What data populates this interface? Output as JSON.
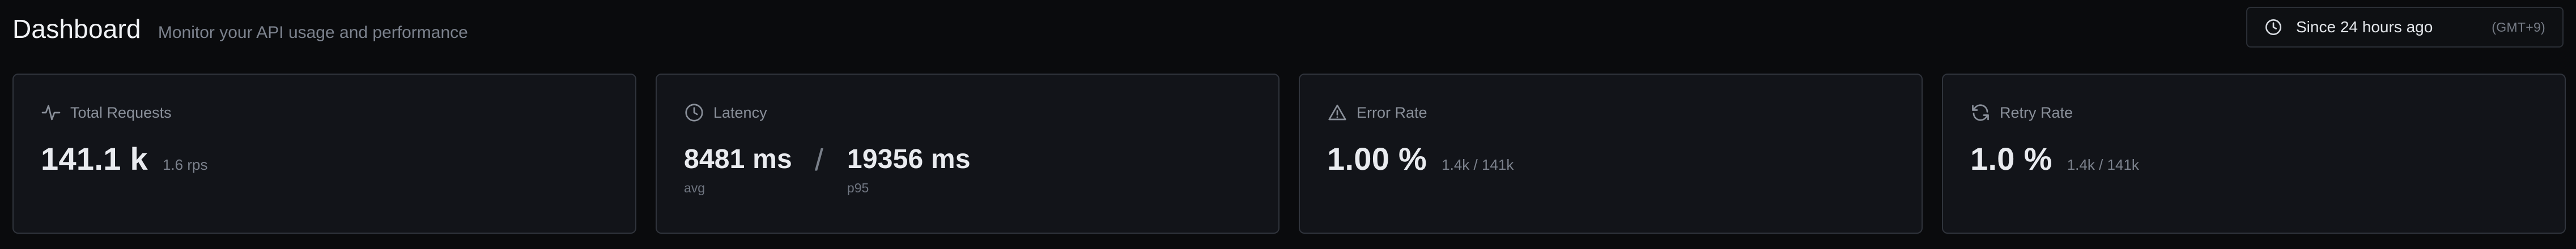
{
  "header": {
    "title": "Dashboard",
    "subtitle": "Monitor your API usage and performance",
    "time_range_label": "Since 24 hours ago",
    "timezone": "(GMT+9)",
    "time_icon": "clock-icon"
  },
  "cards": [
    {
      "label": "Total Requests",
      "icon": "activity-icon",
      "value": "141.1 k",
      "sub": "1.6 rps"
    },
    {
      "label": "Latency",
      "icon": "clock-icon",
      "avg_value": "8481 ms",
      "avg_label": "avg",
      "separator": "/",
      "p95_value": "19356 ms",
      "p95_label": "p95"
    },
    {
      "label": "Error Rate",
      "icon": "warning-triangle-icon",
      "value": "1.00 %",
      "sub": "1.4k / 141k"
    },
    {
      "label": "Retry Rate",
      "icon": "refresh-icon",
      "value": "1.0 %",
      "sub": "1.4k / 141k"
    }
  ]
}
